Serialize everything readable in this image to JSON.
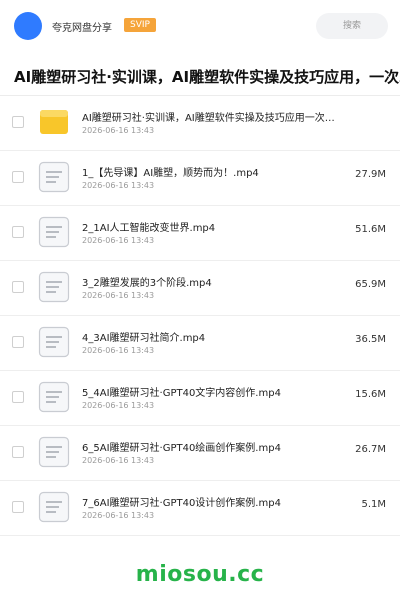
{
  "header": {
    "site_name": "夸克网盘分享",
    "badge": "SVIP",
    "search_label": "搜索"
  },
  "title": "AI雕塑研习社·实训课，AI雕塑软件实操及技巧应用，一次掌握",
  "files": [
    {
      "name": "AI雕塑研习社·实训课，AI雕塑软件实操及技巧应用一次掌握",
      "date": "2026-06-16 13:43",
      "size": "",
      "type": "folder-icon"
    },
    {
      "name": "1_【先导课】AI雕塑，顺势而为！.mp4",
      "date": "2026-06-16 13:43",
      "size": "27.9M",
      "type": "video-file-icon"
    },
    {
      "name": "2_1AI人工智能改变世界.mp4",
      "date": "2026-06-16 13:43",
      "size": "51.6M",
      "type": "video-file-icon"
    },
    {
      "name": "3_2雕塑发展的3个阶段.mp4",
      "date": "2026-06-16 13:43",
      "size": "65.9M",
      "type": "video-file-icon"
    },
    {
      "name": "4_3AI雕塑研习社简介.mp4",
      "date": "2026-06-16 13:43",
      "size": "36.5M",
      "type": "video-file-icon"
    },
    {
      "name": "5_4AI雕塑研习社·GPT40文字内容创作.mp4",
      "date": "2026-06-16 13:43",
      "size": "15.6M",
      "type": "video-file-icon"
    },
    {
      "name": "6_5AI雕塑研习社·GPT40绘画创作案例.mp4",
      "date": "2026-06-16 13:43",
      "size": "26.7M",
      "type": "video-file-icon"
    },
    {
      "name": "7_6AI雕塑研习社·GPT40设计创作案例.mp4",
      "date": "2026-06-16 13:43",
      "size": "5.1M",
      "type": "video-file-icon"
    }
  ],
  "watermark": "miosou.cc",
  "colors": {
    "accent": "#2f7bff",
    "badge": "#f5a43a",
    "folder": "#f8c62a",
    "watermark": "#27b34a"
  }
}
